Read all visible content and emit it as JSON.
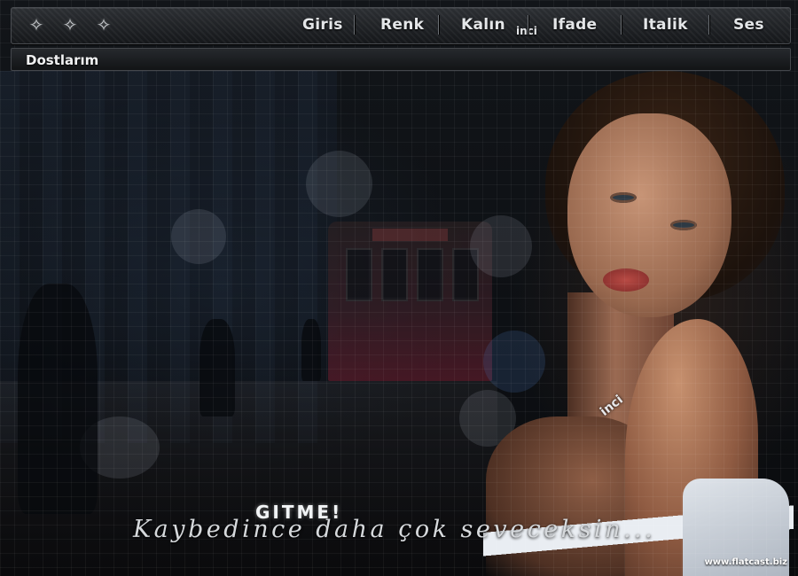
{
  "nav": {
    "ornaments": [
      "✧",
      "✧",
      "✧"
    ],
    "items": [
      {
        "label": "Giris"
      },
      {
        "label": "Renk"
      },
      {
        "label": "Kalın"
      },
      {
        "label": "Ifade"
      },
      {
        "label": "Italik"
      },
      {
        "label": "Ses"
      }
    ],
    "inci_label": "inci"
  },
  "friends": {
    "label": "Dostlarım"
  },
  "scene": {
    "title": "GITME!",
    "tagline": "Kaybedince daha çok seveceksin...",
    "necklace": "inci",
    "watermark": "www.flatcast.biz"
  },
  "colors": {
    "bar_dark": "#15171a",
    "text_light": "#e4e6e8",
    "tram_red": "#5a1b2a"
  },
  "icons": [
    "diamond-ornament-icon"
  ]
}
